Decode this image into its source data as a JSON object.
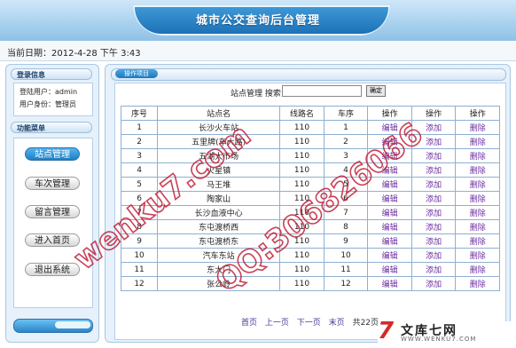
{
  "header": {
    "title": "城市公交查询后台管理"
  },
  "datebar": {
    "text": "当前日期：2012-4-28 下午 3:43"
  },
  "sidebar": {
    "login_title": "登录信息",
    "user_line": "登陆用户：admin",
    "role_line": "用户身份：管理员",
    "menu_title": "功能菜单",
    "menu": [
      {
        "label": "站点管理"
      },
      {
        "label": "车次管理"
      },
      {
        "label": "留言管理"
      },
      {
        "label": "进入首页"
      },
      {
        "label": "退出系统"
      }
    ]
  },
  "main": {
    "title": "操作项目",
    "search": {
      "label": "站点管理 搜索",
      "value": "",
      "button": "确定"
    },
    "headers": [
      "序号",
      "站点名",
      "线路名",
      "车序",
      "操作",
      "操作",
      "操作"
    ],
    "rows": [
      {
        "no": "1",
        "name": "长沙火车站",
        "line": "110",
        "order": "1",
        "edit": "编辑",
        "add": "添加",
        "del": "删除"
      },
      {
        "no": "2",
        "name": "五里牌(车大路)",
        "line": "110",
        "order": "2",
        "edit": "编辑",
        "add": "添加",
        "del": "删除"
      },
      {
        "no": "3",
        "name": "五湖大市场",
        "line": "110",
        "order": "3",
        "edit": "编辑",
        "add": "添加",
        "del": "删除"
      },
      {
        "no": "4",
        "name": "火星镇",
        "line": "110",
        "order": "4",
        "edit": "编辑",
        "add": "添加",
        "del": "删除"
      },
      {
        "no": "5",
        "name": "马王堆",
        "line": "110",
        "order": "5",
        "edit": "编辑",
        "add": "添加",
        "del": "删除"
      },
      {
        "no": "6",
        "name": "陶家山",
        "line": "110",
        "order": "6",
        "edit": "编辑",
        "add": "添加",
        "del": "删除"
      },
      {
        "no": "7",
        "name": "长沙血液中心",
        "line": "110",
        "order": "7",
        "edit": "编辑",
        "add": "添加",
        "del": "删除"
      },
      {
        "no": "8",
        "name": "东屯渡桥西",
        "line": "110",
        "order": "8",
        "edit": "编辑",
        "add": "添加",
        "del": "删除"
      },
      {
        "no": "9",
        "name": "东屯渡桥东",
        "line": "110",
        "order": "9",
        "edit": "编辑",
        "add": "添加",
        "del": "删除"
      },
      {
        "no": "10",
        "name": "汽车东站",
        "line": "110",
        "order": "10",
        "edit": "编辑",
        "add": "添加",
        "del": "删除"
      },
      {
        "no": "11",
        "name": "东大门",
        "line": "110",
        "order": "11",
        "edit": "编辑",
        "add": "添加",
        "del": "删除"
      },
      {
        "no": "12",
        "name": "张公岭",
        "line": "110",
        "order": "12",
        "edit": "编辑",
        "add": "添加",
        "del": "删除"
      }
    ],
    "pager": {
      "first": "首页",
      "prev": "上一页",
      "next": "下一页",
      "last": "末页",
      "total": "共22页"
    }
  },
  "watermark": {
    "text1": "wenku7.com",
    "text2": "QQ:306826066",
    "logo_main": "文库七网",
    "logo_url": "WWW.WENKU7.COM"
  }
}
